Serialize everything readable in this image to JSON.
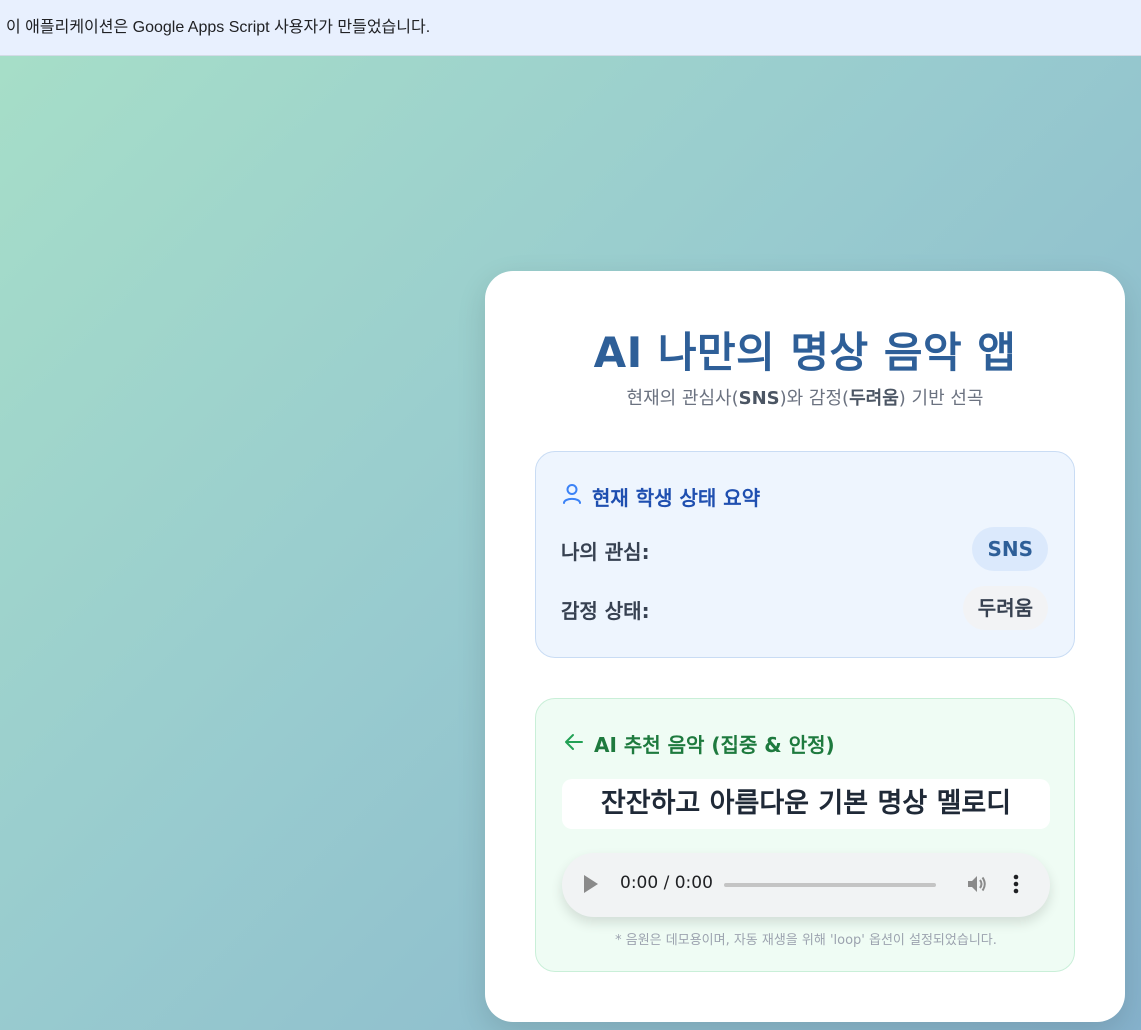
{
  "banner": {
    "text": "이 애플리케이션은 Google Apps Script 사용자가 만들었습니다."
  },
  "app": {
    "title": "AI 나만의 명상 음악 앱",
    "subtitle_prefix": "현재의 관심사(",
    "subtitle_interest": "SNS",
    "subtitle_mid": ")와 감정(",
    "subtitle_emotion": "두려움",
    "subtitle_suffix": ") 기반 선곡"
  },
  "status": {
    "heading": "현재 학생 상태 요약",
    "icon": "user-icon",
    "interest_label": "나의 관심:",
    "interest_value": "SNS",
    "emotion_label": "감정 상태:",
    "emotion_value": "두려움"
  },
  "music": {
    "heading": "AI 추천 음악 (집중 & 안정)",
    "icon": "arrow-left-icon",
    "song_title": "잔잔하고 아름다운 기본 명상 멜로디",
    "player": {
      "time": "0:00 / 0:00",
      "progress": 0
    },
    "note": "* 음원은 데모용이며, 자동 재생을 위해 'loop' 옵션이 설정되었습니다."
  },
  "colors": {
    "title": "#2e5f98",
    "status_heading": "#1f4fb0",
    "music_heading": "#1e7a3e",
    "banner_bg": "#e8f0fe"
  }
}
